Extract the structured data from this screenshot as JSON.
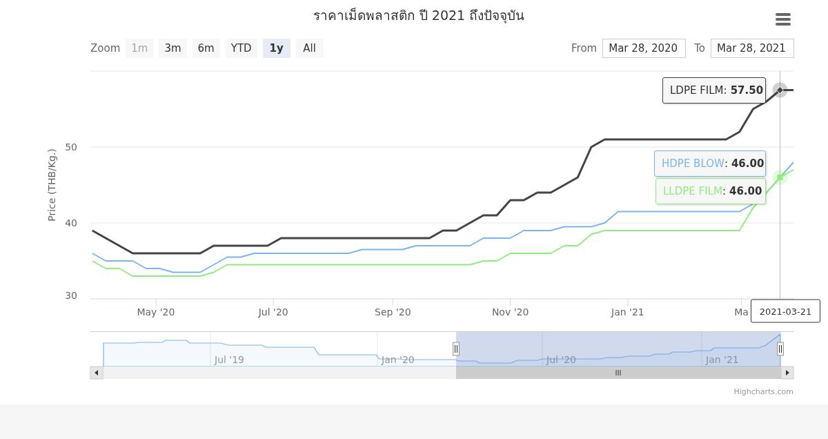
{
  "chart_title": "ราคาเม็ดพลาสติก ปี 2021 ถึงปัจจุบัน",
  "range_selector": {
    "label": "Zoom",
    "buttons": [
      {
        "label": "1m",
        "disabled": true,
        "selected": false
      },
      {
        "label": "3m",
        "disabled": false,
        "selected": false
      },
      {
        "label": "6m",
        "disabled": false,
        "selected": false
      },
      {
        "label": "YTD",
        "disabled": false,
        "selected": false
      },
      {
        "label": "1y",
        "disabled": false,
        "selected": true
      },
      {
        "label": "All",
        "disabled": false,
        "selected": false
      }
    ],
    "from_label": "From",
    "from_value": "Mar 28, 2020",
    "to_label": "To",
    "to_value": "Mar 28, 2021"
  },
  "chart_data": {
    "type": "line",
    "ylabel": "Price (THB/Kg.)",
    "xlim": [
      "2020-03-28",
      "2021-03-28"
    ],
    "ylim": [
      30,
      60
    ],
    "yticks": [
      30,
      40,
      50
    ],
    "xticks": [
      {
        "value": "2020-05-01",
        "label": "May '20"
      },
      {
        "value": "2020-07-01",
        "label": "Jul '20"
      },
      {
        "value": "2020-09-01",
        "label": "Sep '20"
      },
      {
        "value": "2020-11-01",
        "label": "Nov '20"
      },
      {
        "value": "2021-01-01",
        "label": "Jan '21"
      },
      {
        "value": "2021-03-01",
        "label": "Ma"
      }
    ],
    "x": [
      "2020-03-29",
      "2020-04-05",
      "2020-04-12",
      "2020-04-19",
      "2020-04-26",
      "2020-05-03",
      "2020-05-10",
      "2020-05-17",
      "2020-05-24",
      "2020-05-31",
      "2020-06-07",
      "2020-06-14",
      "2020-06-21",
      "2020-06-28",
      "2020-07-05",
      "2020-07-12",
      "2020-07-19",
      "2020-07-26",
      "2020-08-02",
      "2020-08-09",
      "2020-08-16",
      "2020-08-23",
      "2020-08-30",
      "2020-09-06",
      "2020-09-13",
      "2020-09-20",
      "2020-09-27",
      "2020-10-04",
      "2020-10-11",
      "2020-10-18",
      "2020-10-25",
      "2020-11-01",
      "2020-11-08",
      "2020-11-15",
      "2020-11-22",
      "2020-11-29",
      "2020-12-06",
      "2020-12-13",
      "2020-12-20",
      "2020-12-27",
      "2021-01-03",
      "2021-01-10",
      "2021-01-17",
      "2021-01-24",
      "2021-01-31",
      "2021-02-07",
      "2021-02-14",
      "2021-02-21",
      "2021-02-28",
      "2021-03-07",
      "2021-03-14",
      "2021-03-21",
      "2021-03-28"
    ],
    "series": [
      {
        "name": "LDPE FILM",
        "color": "#434348",
        "values": [
          39,
          38,
          37,
          36,
          36,
          36,
          36,
          36,
          36,
          37,
          37,
          37,
          37,
          37,
          38,
          38,
          38,
          38,
          38,
          38,
          38,
          38,
          38,
          38,
          38,
          38,
          39,
          39,
          40,
          41,
          41,
          43,
          43,
          44,
          44,
          45,
          46,
          50,
          51,
          51,
          51,
          51,
          51,
          51,
          51,
          51,
          51,
          51,
          52,
          55,
          56,
          57.5,
          57.5
        ]
      },
      {
        "name": "HDPE BLOW",
        "color": "#7cb5ec",
        "values": [
          36,
          35,
          35,
          35,
          34,
          34,
          33.5,
          33.5,
          33.5,
          34.5,
          35.5,
          35.5,
          36,
          36,
          36,
          36,
          36,
          36,
          36,
          36,
          36.5,
          36.5,
          36.5,
          36.5,
          37,
          37,
          37,
          37,
          37,
          38,
          38,
          38,
          39,
          39,
          39,
          39.5,
          39.5,
          39.5,
          40,
          41.5,
          41.5,
          41.5,
          41.5,
          41.5,
          41.5,
          41.5,
          41.5,
          41.5,
          41.5,
          42.5,
          44,
          46,
          48
        ]
      },
      {
        "name": "LLDPE FILM",
        "color": "#90ed7d",
        "values": [
          35,
          34,
          34,
          33,
          33,
          33,
          33,
          33,
          33,
          33.5,
          34.5,
          34.5,
          34.5,
          34.5,
          34.5,
          34.5,
          34.5,
          34.5,
          34.5,
          34.5,
          34.5,
          34.5,
          34.5,
          34.5,
          34.5,
          34.5,
          34.5,
          34.5,
          34.5,
          35,
          35,
          36,
          36,
          36,
          36,
          37,
          37,
          38.5,
          39,
          39,
          39,
          39,
          39,
          39,
          39,
          39,
          39,
          39,
          39,
          42,
          44,
          46,
          47
        ]
      }
    ],
    "ref_lines": [
      {
        "axis": "x",
        "value": "2021-03-21",
        "label": "2021-03-21"
      }
    ]
  },
  "tooltips": [
    {
      "separator": ":",
      "value": "57.50"
    },
    {
      "separator": ":",
      "value": "46.00"
    },
    {
      "separator": ":",
      "value": "46.00"
    }
  ],
  "navigator": {
    "labels": [
      "Jul '19",
      "Jan '20",
      "Jul '20",
      "Jan '21"
    ]
  },
  "credits": "Highcharts.com"
}
